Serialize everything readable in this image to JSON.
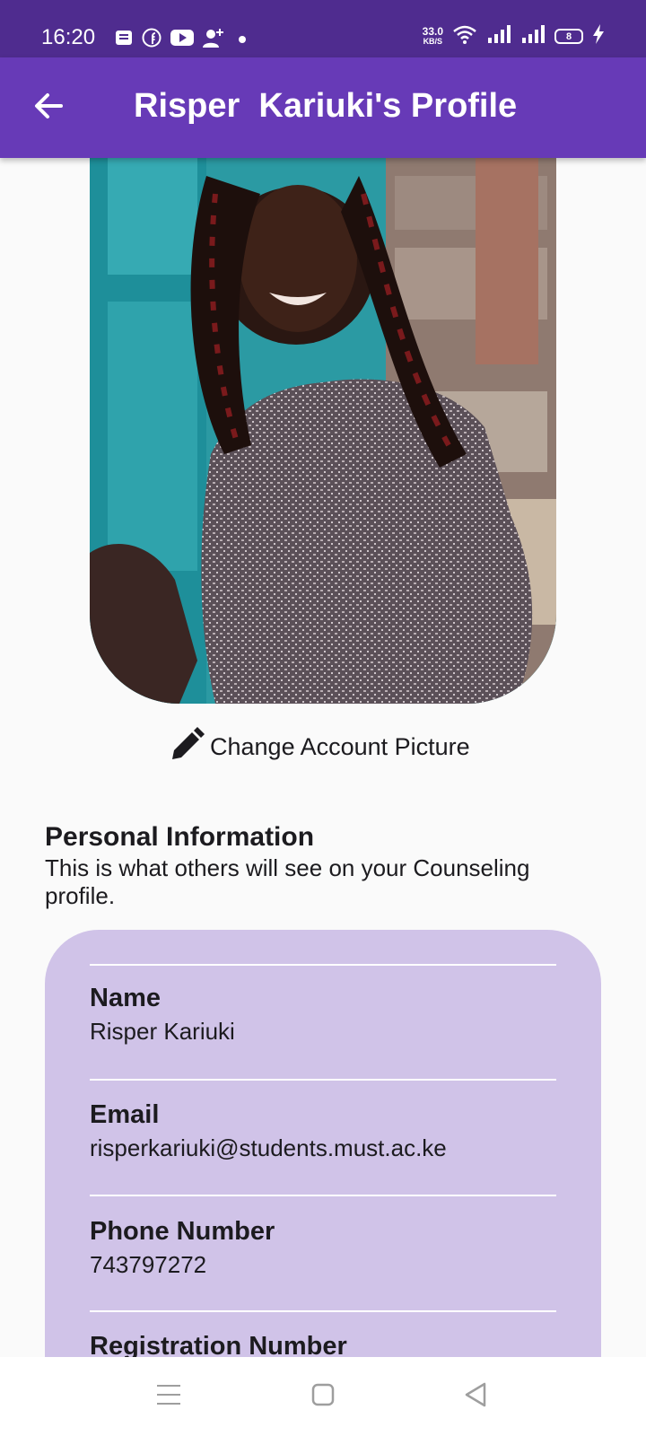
{
  "status_bar": {
    "time": "16:20",
    "net_speed_value": "33.0",
    "net_speed_unit": "KB/S",
    "battery_level": "8",
    "left_icons": [
      "message-icon",
      "facebook-icon",
      "youtube-icon",
      "add-person-icon",
      "dot-icon"
    ],
    "right_icons": [
      "wifi-icon",
      "signal-icon",
      "signal-icon",
      "battery-icon",
      "charging-icon"
    ]
  },
  "app_bar": {
    "title": "Risper  Kariuki's Profile",
    "back_icon": "arrow-back-icon",
    "color": "#673ab7"
  },
  "profile": {
    "change_picture_label": "Change Account Picture",
    "edit_icon": "pencil-icon"
  },
  "personal_info": {
    "title": "Personal Information",
    "subtitle": "This is what others will see on your Counseling profile.",
    "card_color": "#d0c3e8",
    "fields": [
      {
        "label": "Name",
        "value": "Risper Kariuki"
      },
      {
        "label": "Email",
        "value": "risperkariuki@students.must.ac.ke"
      },
      {
        "label": "Phone Number",
        "value": "743797272"
      },
      {
        "label": "Registration Number",
        "value": ""
      }
    ]
  },
  "nav_bar": {
    "icons": [
      "menu-icon",
      "home-square-icon",
      "back-triangle-icon"
    ]
  }
}
